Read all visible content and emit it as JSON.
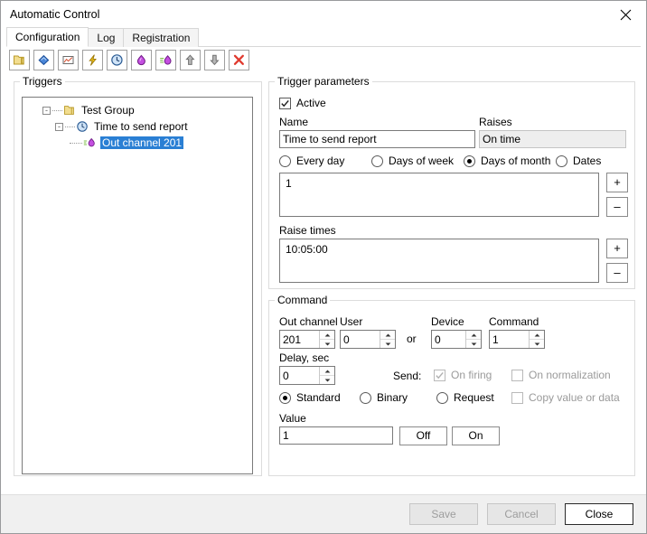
{
  "window": {
    "title": "Automatic Control",
    "close_icon": "close-icon"
  },
  "tabs": [
    {
      "label": "Configuration",
      "active": true
    },
    {
      "label": "Log",
      "active": false
    },
    {
      "label": "Registration",
      "active": false
    }
  ],
  "toolbar": {
    "buttons": [
      {
        "name": "new-group-icon",
        "title": "folder"
      },
      {
        "name": "edit-diamond-blue-icon",
        "title": "blue diamond"
      },
      {
        "name": "chart-icon",
        "title": "chart"
      },
      {
        "name": "lightning-icon",
        "title": "lightning"
      },
      {
        "name": "clock-icon",
        "title": "clock"
      },
      {
        "name": "diamond-purple-icon",
        "title": "purple diamond"
      },
      {
        "name": "diamond-purple-lines-icon",
        "title": "purple diamond with lines"
      },
      {
        "name": "arrow-up-icon",
        "title": "move up"
      },
      {
        "name": "arrow-down-icon",
        "title": "move down"
      },
      {
        "name": "delete-icon",
        "title": "delete"
      }
    ]
  },
  "triggers": {
    "legend": "Triggers",
    "tree": {
      "group": {
        "label": "Test Group",
        "expander": "-"
      },
      "trigger": {
        "label": "Time to send report",
        "expander": "-"
      },
      "action": {
        "label": "Out channel 201",
        "selected": true
      }
    }
  },
  "trigger_parameters": {
    "legend": "Trigger parameters",
    "active": {
      "label": "Active",
      "checked": true
    },
    "name": {
      "label": "Name",
      "value": "Time to send report"
    },
    "raises": {
      "label": "Raises",
      "value": "On time",
      "readonly": true
    },
    "schedule_modes": [
      {
        "label": "Every day",
        "checked": false
      },
      {
        "label": "Days of week",
        "checked": false
      },
      {
        "label": "Days of month",
        "checked": true
      },
      {
        "label": "Dates",
        "checked": false
      }
    ],
    "days_list": {
      "items": [
        "1"
      ]
    },
    "days_add": "+",
    "days_remove": "–",
    "raise_times": {
      "label": "Raise times",
      "items": [
        "10:05:00"
      ]
    },
    "times_add": "+",
    "times_remove": "–"
  },
  "command": {
    "legend": "Command",
    "out_channel": {
      "label": "Out channel",
      "value": "201"
    },
    "user": {
      "label": "User",
      "value": "0"
    },
    "or_label": "or",
    "device": {
      "label": "Device",
      "value": "0"
    },
    "command_num": {
      "label": "Command",
      "value": "1"
    },
    "delay": {
      "label": "Delay, sec",
      "value": "0"
    },
    "send_label": "Send:",
    "on_firing": {
      "label": "On firing",
      "checked": true,
      "disabled": true
    },
    "on_normalization": {
      "label": "On normalization",
      "checked": false,
      "disabled": true
    },
    "cmd_types": [
      {
        "label": "Standard",
        "checked": true
      },
      {
        "label": "Binary",
        "checked": false
      },
      {
        "label": "Request",
        "checked": false
      }
    ],
    "copy_value": {
      "label": "Copy value or data",
      "checked": false,
      "disabled": true
    },
    "value": {
      "label": "Value",
      "value": "1"
    },
    "off_button": "Off",
    "on_button": "On"
  },
  "footer": {
    "save": {
      "label": "Save",
      "enabled": false
    },
    "cancel": {
      "label": "Cancel",
      "enabled": false
    },
    "close": {
      "label": "Close",
      "enabled": true
    }
  },
  "colors": {
    "selection": "#2a7fd4",
    "accent_yellow": "#e8c84a",
    "accent_blue": "#3a78d0",
    "accent_purple": "#b14fd8",
    "delete_red": "#e03a2f"
  }
}
